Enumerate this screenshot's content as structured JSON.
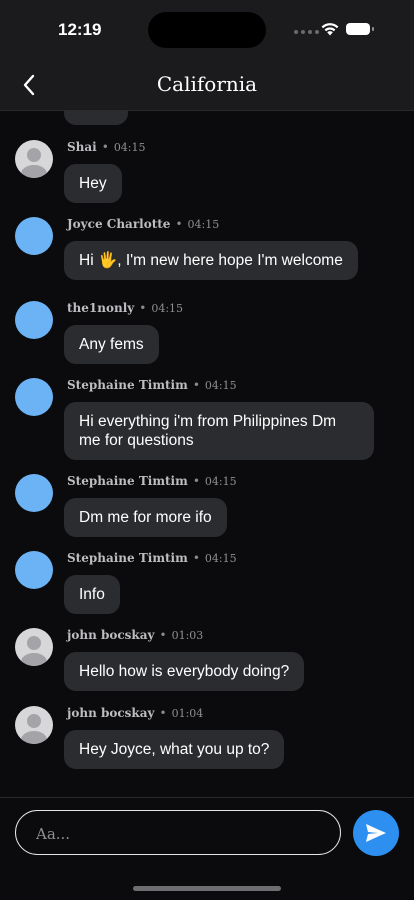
{
  "status": {
    "time": "12:19"
  },
  "header": {
    "title": "California"
  },
  "messages": [
    {
      "name": "Shai",
      "time": "04:15",
      "text": "Hey",
      "avatar": "default-avatar-icon"
    },
    {
      "name": "Joyce Charlotte",
      "time": "04:15",
      "text": "Hi 🖐, I'm new here hope I'm welcome",
      "avatar": "blue"
    },
    {
      "name": "the1nonly",
      "time": "04:15",
      "text": "Any fems",
      "avatar": "blue"
    },
    {
      "name": "Stephaine Timtim",
      "time": "04:15",
      "text": "Hi everything i'm from Philippines Dm me for questions",
      "avatar": "blue"
    },
    {
      "name": "Stephaine Timtim",
      "time": "04:15",
      "text": "Dm me for more ifo",
      "avatar": "blue"
    },
    {
      "name": "Stephaine Timtim",
      "time": "04:15",
      "text": "Info",
      "avatar": "blue"
    },
    {
      "name": "john bocskay",
      "time": "01:03",
      "text": "Hello how is everybody doing?",
      "avatar": "default-avatar-icon"
    },
    {
      "name": "john bocskay",
      "time": "01:04",
      "text": "Hey Joyce, what you up to?",
      "avatar": "default-avatar-icon"
    }
  ],
  "composer": {
    "placeholder": "Aa..."
  },
  "colors": {
    "accent": "#2d8ff0",
    "avatar_blue": "#6cb3f5",
    "bubble": "#2a2c30",
    "background": "#0b0b0d"
  }
}
